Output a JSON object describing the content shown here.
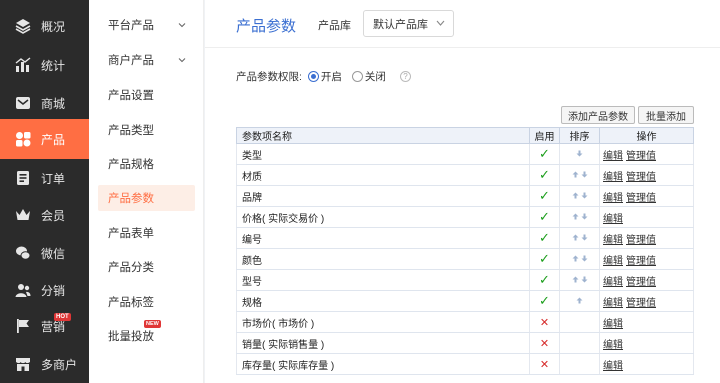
{
  "sidebar": {
    "items": [
      {
        "label": "概况",
        "icon": "layers-icon"
      },
      {
        "label": "统计",
        "icon": "stats-icon"
      },
      {
        "label": "商城",
        "icon": "mail-icon"
      },
      {
        "label": "产品",
        "icon": "apps-icon",
        "active": true
      },
      {
        "label": "订单",
        "icon": "order-icon"
      },
      {
        "label": "会员",
        "icon": "crown-icon"
      },
      {
        "label": "微信",
        "icon": "wechat-icon"
      },
      {
        "label": "分销",
        "icon": "users-icon"
      },
      {
        "label": "营销",
        "icon": "flag-icon",
        "badge": "HOT"
      },
      {
        "label": "多商户",
        "icon": "shop-icon"
      }
    ]
  },
  "submenu": {
    "items": [
      {
        "label": "平台产品",
        "expandable": true
      },
      {
        "label": "商户产品",
        "expandable": true
      },
      {
        "label": "产品设置"
      },
      {
        "label": "产品类型"
      },
      {
        "label": "产品规格"
      },
      {
        "label": "产品参数",
        "active": true
      },
      {
        "label": "产品表单"
      },
      {
        "label": "产品分类"
      },
      {
        "label": "产品标签"
      },
      {
        "label": "批量投放",
        "badge": "NEW"
      }
    ]
  },
  "header": {
    "title": "产品参数",
    "library_label": "产品库",
    "library_value": "默认产品库"
  },
  "permission": {
    "label": "产品参数权限:",
    "on_label": "开启",
    "off_label": "关闭",
    "help": "?",
    "selected": "on"
  },
  "buttons": {
    "add": "添加产品参数",
    "batch_add": "批量添加"
  },
  "table": {
    "headers": {
      "name": "参数项名称",
      "enabled": "启用",
      "sort": "排序",
      "ops": "操作"
    },
    "edit_label": "编辑",
    "manage_label": "管理值",
    "rows": [
      {
        "name": "类型",
        "enabled": true,
        "sort": [
          "down"
        ],
        "manage": true
      },
      {
        "name": "材质",
        "enabled": true,
        "sort": [
          "up",
          "down"
        ],
        "manage": true
      },
      {
        "name": "品牌",
        "enabled": true,
        "sort": [
          "up",
          "down"
        ],
        "manage": true
      },
      {
        "name": "价格( 实际交易价 )",
        "enabled": true,
        "sort": [
          "up",
          "down"
        ],
        "manage": false
      },
      {
        "name": "编号",
        "enabled": true,
        "sort": [
          "up",
          "down"
        ],
        "manage": true
      },
      {
        "name": "颜色",
        "enabled": true,
        "sort": [
          "up",
          "down"
        ],
        "manage": true
      },
      {
        "name": "型号",
        "enabled": true,
        "sort": [
          "up",
          "down"
        ],
        "manage": true
      },
      {
        "name": "规格",
        "enabled": true,
        "sort": [
          "up"
        ],
        "manage": true
      },
      {
        "name": "市场价( 市场价 )",
        "enabled": false,
        "sort": [],
        "manage": false
      },
      {
        "name": "销量( 实际销售量 )",
        "enabled": false,
        "sort": [],
        "manage": false
      },
      {
        "name": "库存量( 实际库存量 )",
        "enabled": false,
        "sort": [],
        "manage": false
      }
    ]
  },
  "colors": {
    "accent": "#ff6e43",
    "link_blue": "#3b6fd1",
    "sidebar_bg": "#2b2b2b",
    "check_green": "#1b9e1b",
    "cross_red": "#d62b2b"
  }
}
